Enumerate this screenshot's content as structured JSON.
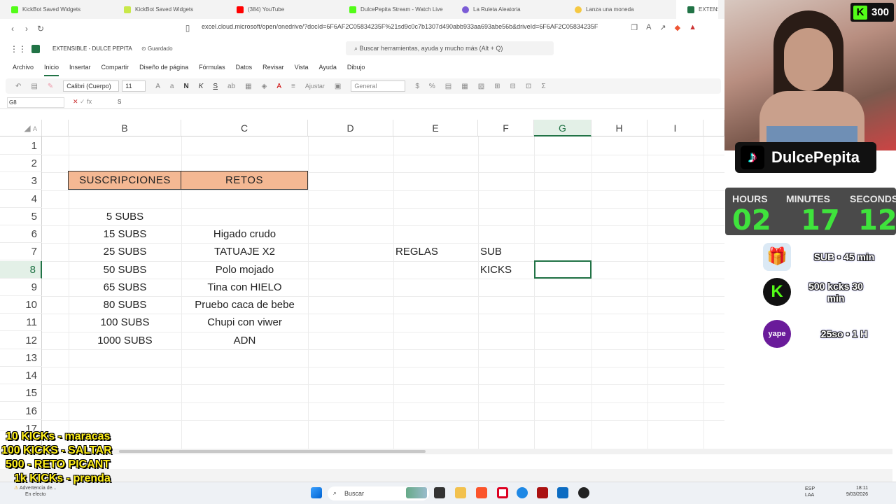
{
  "browser": {
    "tabs": [
      {
        "label": "KickBot Saved Widgets",
        "color": "#53fc18"
      },
      {
        "label": "KickBot Saved Widgets",
        "color": "#c9e84a"
      },
      {
        "label": "(384) YouTube",
        "color": "#ff0000"
      },
      {
        "label": "DulcePepita Stream - Watch Live",
        "color": "#53fc18"
      },
      {
        "label": "La Ruleta Aleatoria",
        "color": "#7b5cd6"
      },
      {
        "label": "Lanza una moneda",
        "color": "#f5c842"
      },
      {
        "label": "EXTENSIB",
        "color": "#217346"
      }
    ],
    "url": "excel.cloud.microsoft/open/onedrive/?docId=6F6AF2C05834235F%21sd9c0c7b1307d490abb933aa693abe56b&driveId=6F6AF2C05834235F"
  },
  "excel": {
    "title": "EXTENSIBLE - DULCE PEPITA",
    "saved_status": "Guardado",
    "search_placeholder": "Buscar herramientas, ayuda y mucho más (Alt + Q)",
    "ribbon_tabs": [
      "Archivo",
      "Inicio",
      "Insertar",
      "Compartir",
      "Diseño de página",
      "Fórmulas",
      "Datos",
      "Revisar",
      "Vista",
      "Ayuda",
      "Dibujo"
    ],
    "font_name": "Calibri (Cuerpo)",
    "font_size": "11",
    "number_format": "General",
    "align_label": "Ajustar",
    "name_box": "G8",
    "formula_value": "S",
    "columns": [
      "A",
      "B",
      "C",
      "D",
      "E",
      "F",
      "G",
      "H",
      "I"
    ],
    "rows": [
      "1",
      "2",
      "3",
      "4",
      "5",
      "6",
      "7",
      "8",
      "9",
      "10",
      "11",
      "12",
      "13",
      "14",
      "15",
      "16",
      "17"
    ],
    "header_suscripciones": "SUSCRIPCIONES",
    "header_retos": "RETOS",
    "subs": [
      "5 SUBS",
      "15 SUBS",
      "25 SUBS",
      "50 SUBS",
      "65 SUBS",
      "80 SUBS",
      "100 SUBS",
      "1000 SUBS"
    ],
    "retos": [
      "",
      "Higado crudo",
      "TATUAJE X2",
      "Polo mojado",
      "Tina con HIELO",
      "Pruebo caca de bebe",
      "Chupi con viwer",
      "ADN"
    ],
    "reglas_label": "REGLAS",
    "sub_label": "SUB",
    "kicks_label": "KICKS"
  },
  "taskbar": {
    "search": "Buscar",
    "lang": "ESP",
    "lang2": "LAA",
    "time": "18:11",
    "date": "9/03/2026",
    "notice_title": "Advertencia de...",
    "notice_sub": "En efecto"
  },
  "overlay": {
    "kick_count": "300",
    "channel": "DulcePepita",
    "timer": {
      "hours_label": "HOURS",
      "minutes_label": "MINUTES",
      "seconds_label": "SECONDS",
      "hours": "02",
      "minutes": "17",
      "seconds": "12"
    },
    "perks": [
      {
        "icon": "gift-icon",
        "text": "SUB • 45 min"
      },
      {
        "icon": "kick-icon",
        "text": "500 kcks 30 min"
      },
      {
        "icon": "yape-icon",
        "text": "25so • 1 H"
      }
    ],
    "rules": [
      "10 KICKs - maracas",
      "100 KICKS - SALTAR",
      "500 - RETO PICANT",
      "1k KICKs - prenda"
    ]
  }
}
